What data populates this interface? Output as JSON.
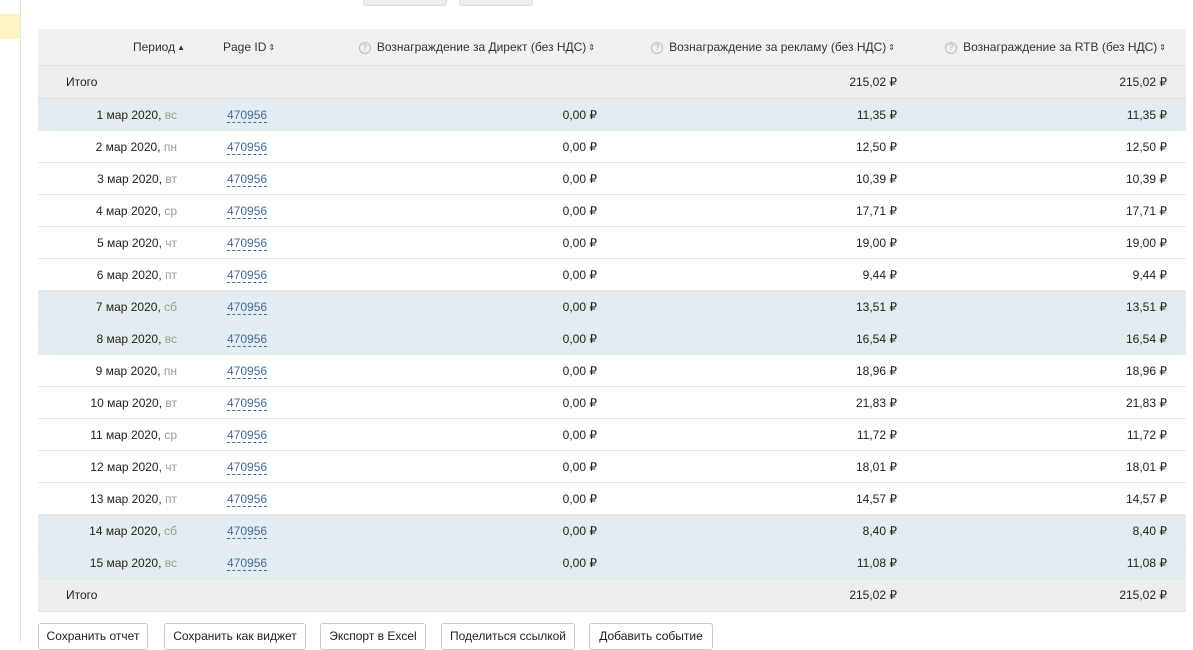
{
  "table": {
    "headers": {
      "period": "Период",
      "page_id": "Page ID",
      "direct": "Вознаграждение за Директ (без НДС)",
      "ads": "Вознаграждение за рекламу (без НДС)",
      "rtb": "Вознаграждение за RTB (без НДС)"
    },
    "total_label": "Итого",
    "totals": {
      "direct": "",
      "ads": "215,02 ₽",
      "rtb": "215,02 ₽"
    },
    "rows": [
      {
        "date": "1 мар 2020, ",
        "dow": "вс",
        "page_id": "470956",
        "direct": "0,00 ₽",
        "ads": "11,35 ₽",
        "rtb": "11,35 ₽",
        "weekend": true
      },
      {
        "date": "2 мар 2020, ",
        "dow": "пн",
        "page_id": "470956",
        "direct": "0,00 ₽",
        "ads": "12,50 ₽",
        "rtb": "12,50 ₽",
        "weekend": false
      },
      {
        "date": "3 мар 2020, ",
        "dow": "вт",
        "page_id": "470956",
        "direct": "0,00 ₽",
        "ads": "10,39 ₽",
        "rtb": "10,39 ₽",
        "weekend": false
      },
      {
        "date": "4 мар 2020, ",
        "dow": "ср",
        "page_id": "470956",
        "direct": "0,00 ₽",
        "ads": "17,71 ₽",
        "rtb": "17,71 ₽",
        "weekend": false
      },
      {
        "date": "5 мар 2020, ",
        "dow": "чт",
        "page_id": "470956",
        "direct": "0,00 ₽",
        "ads": "19,00 ₽",
        "rtb": "19,00 ₽",
        "weekend": false
      },
      {
        "date": "6 мар 2020, ",
        "dow": "пт",
        "page_id": "470956",
        "direct": "0,00 ₽",
        "ads": "9,44 ₽",
        "rtb": "9,44 ₽",
        "weekend": false
      },
      {
        "date": "7 мар 2020, ",
        "dow": "сб",
        "page_id": "470956",
        "direct": "0,00 ₽",
        "ads": "13,51 ₽",
        "rtb": "13,51 ₽",
        "weekend": true
      },
      {
        "date": "8 мар 2020, ",
        "dow": "вс",
        "page_id": "470956",
        "direct": "0,00 ₽",
        "ads": "16,54 ₽",
        "rtb": "16,54 ₽",
        "weekend": true
      },
      {
        "date": "9 мар 2020, ",
        "dow": "пн",
        "page_id": "470956",
        "direct": "0,00 ₽",
        "ads": "18,96 ₽",
        "rtb": "18,96 ₽",
        "weekend": false
      },
      {
        "date": "10 мар 2020, ",
        "dow": "вт",
        "page_id": "470956",
        "direct": "0,00 ₽",
        "ads": "21,83 ₽",
        "rtb": "21,83 ₽",
        "weekend": false
      },
      {
        "date": "11 мар 2020, ",
        "dow": "ср",
        "page_id": "470956",
        "direct": "0,00 ₽",
        "ads": "11,72 ₽",
        "rtb": "11,72 ₽",
        "weekend": false
      },
      {
        "date": "12 мар 2020, ",
        "dow": "чт",
        "page_id": "470956",
        "direct": "0,00 ₽",
        "ads": "18,01 ₽",
        "rtb": "18,01 ₽",
        "weekend": false
      },
      {
        "date": "13 мар 2020, ",
        "dow": "пт",
        "page_id": "470956",
        "direct": "0,00 ₽",
        "ads": "14,57 ₽",
        "rtb": "14,57 ₽",
        "weekend": false
      },
      {
        "date": "14 мар 2020, ",
        "dow": "сб",
        "page_id": "470956",
        "direct": "0,00 ₽",
        "ads": "8,40 ₽",
        "rtb": "8,40 ₽",
        "weekend": true
      },
      {
        "date": "15 мар 2020, ",
        "dow": "вс",
        "page_id": "470956",
        "direct": "0,00 ₽",
        "ads": "11,08 ₽",
        "rtb": "11,08 ₽",
        "weekend": true
      }
    ]
  },
  "actions": {
    "save_report": "Сохранить отчет",
    "save_widget": "Сохранить как виджет",
    "export_excel": "Экспорт в Excel",
    "share_link": "Поделиться ссылкой",
    "add_event": "Добавить событие"
  },
  "colors": {
    "link": "#3d6ca4",
    "weekend_row": "#e3ecf0",
    "total_row": "#eeeeee",
    "header_bg": "#f1f1f1",
    "accent_left": "#fff4c4"
  },
  "icons": {
    "help": "question-circle-icon",
    "sort_asc": "sort-asc-icon",
    "sort_both": "sort-both-icon"
  }
}
